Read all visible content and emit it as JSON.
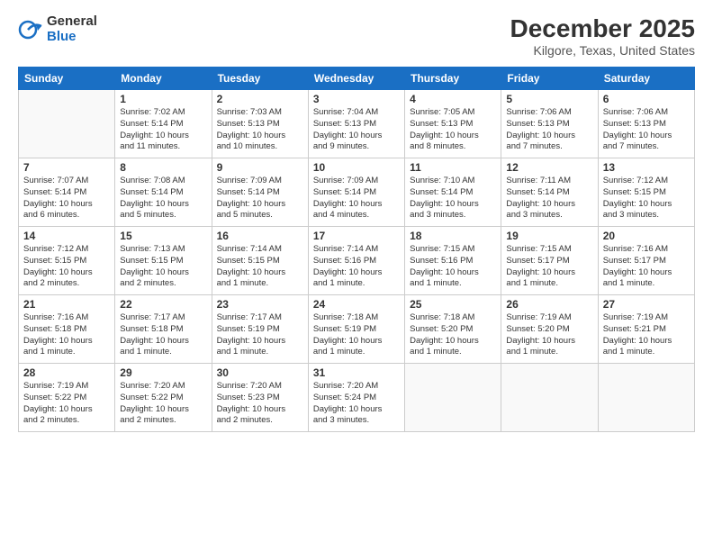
{
  "header": {
    "logo_general": "General",
    "logo_blue": "Blue",
    "month_title": "December 2025",
    "location": "Kilgore, Texas, United States"
  },
  "weekdays": [
    "Sunday",
    "Monday",
    "Tuesday",
    "Wednesday",
    "Thursday",
    "Friday",
    "Saturday"
  ],
  "weeks": [
    [
      {
        "day": "",
        "info": ""
      },
      {
        "day": "1",
        "info": "Sunrise: 7:02 AM\nSunset: 5:14 PM\nDaylight: 10 hours\nand 11 minutes."
      },
      {
        "day": "2",
        "info": "Sunrise: 7:03 AM\nSunset: 5:13 PM\nDaylight: 10 hours\nand 10 minutes."
      },
      {
        "day": "3",
        "info": "Sunrise: 7:04 AM\nSunset: 5:13 PM\nDaylight: 10 hours\nand 9 minutes."
      },
      {
        "day": "4",
        "info": "Sunrise: 7:05 AM\nSunset: 5:13 PM\nDaylight: 10 hours\nand 8 minutes."
      },
      {
        "day": "5",
        "info": "Sunrise: 7:06 AM\nSunset: 5:13 PM\nDaylight: 10 hours\nand 7 minutes."
      },
      {
        "day": "6",
        "info": "Sunrise: 7:06 AM\nSunset: 5:13 PM\nDaylight: 10 hours\nand 7 minutes."
      }
    ],
    [
      {
        "day": "7",
        "info": "Sunrise: 7:07 AM\nSunset: 5:14 PM\nDaylight: 10 hours\nand 6 minutes."
      },
      {
        "day": "8",
        "info": "Sunrise: 7:08 AM\nSunset: 5:14 PM\nDaylight: 10 hours\nand 5 minutes."
      },
      {
        "day": "9",
        "info": "Sunrise: 7:09 AM\nSunset: 5:14 PM\nDaylight: 10 hours\nand 5 minutes."
      },
      {
        "day": "10",
        "info": "Sunrise: 7:09 AM\nSunset: 5:14 PM\nDaylight: 10 hours\nand 4 minutes."
      },
      {
        "day": "11",
        "info": "Sunrise: 7:10 AM\nSunset: 5:14 PM\nDaylight: 10 hours\nand 3 minutes."
      },
      {
        "day": "12",
        "info": "Sunrise: 7:11 AM\nSunset: 5:14 PM\nDaylight: 10 hours\nand 3 minutes."
      },
      {
        "day": "13",
        "info": "Sunrise: 7:12 AM\nSunset: 5:15 PM\nDaylight: 10 hours\nand 3 minutes."
      }
    ],
    [
      {
        "day": "14",
        "info": "Sunrise: 7:12 AM\nSunset: 5:15 PM\nDaylight: 10 hours\nand 2 minutes."
      },
      {
        "day": "15",
        "info": "Sunrise: 7:13 AM\nSunset: 5:15 PM\nDaylight: 10 hours\nand 2 minutes."
      },
      {
        "day": "16",
        "info": "Sunrise: 7:14 AM\nSunset: 5:15 PM\nDaylight: 10 hours\nand 1 minute."
      },
      {
        "day": "17",
        "info": "Sunrise: 7:14 AM\nSunset: 5:16 PM\nDaylight: 10 hours\nand 1 minute."
      },
      {
        "day": "18",
        "info": "Sunrise: 7:15 AM\nSunset: 5:16 PM\nDaylight: 10 hours\nand 1 minute."
      },
      {
        "day": "19",
        "info": "Sunrise: 7:15 AM\nSunset: 5:17 PM\nDaylight: 10 hours\nand 1 minute."
      },
      {
        "day": "20",
        "info": "Sunrise: 7:16 AM\nSunset: 5:17 PM\nDaylight: 10 hours\nand 1 minute."
      }
    ],
    [
      {
        "day": "21",
        "info": "Sunrise: 7:16 AM\nSunset: 5:18 PM\nDaylight: 10 hours\nand 1 minute."
      },
      {
        "day": "22",
        "info": "Sunrise: 7:17 AM\nSunset: 5:18 PM\nDaylight: 10 hours\nand 1 minute."
      },
      {
        "day": "23",
        "info": "Sunrise: 7:17 AM\nSunset: 5:19 PM\nDaylight: 10 hours\nand 1 minute."
      },
      {
        "day": "24",
        "info": "Sunrise: 7:18 AM\nSunset: 5:19 PM\nDaylight: 10 hours\nand 1 minute."
      },
      {
        "day": "25",
        "info": "Sunrise: 7:18 AM\nSunset: 5:20 PM\nDaylight: 10 hours\nand 1 minute."
      },
      {
        "day": "26",
        "info": "Sunrise: 7:19 AM\nSunset: 5:20 PM\nDaylight: 10 hours\nand 1 minute."
      },
      {
        "day": "27",
        "info": "Sunrise: 7:19 AM\nSunset: 5:21 PM\nDaylight: 10 hours\nand 1 minute."
      }
    ],
    [
      {
        "day": "28",
        "info": "Sunrise: 7:19 AM\nSunset: 5:22 PM\nDaylight: 10 hours\nand 2 minutes."
      },
      {
        "day": "29",
        "info": "Sunrise: 7:20 AM\nSunset: 5:22 PM\nDaylight: 10 hours\nand 2 minutes."
      },
      {
        "day": "30",
        "info": "Sunrise: 7:20 AM\nSunset: 5:23 PM\nDaylight: 10 hours\nand 2 minutes."
      },
      {
        "day": "31",
        "info": "Sunrise: 7:20 AM\nSunset: 5:24 PM\nDaylight: 10 hours\nand 3 minutes."
      },
      {
        "day": "",
        "info": ""
      },
      {
        "day": "",
        "info": ""
      },
      {
        "day": "",
        "info": ""
      }
    ]
  ]
}
